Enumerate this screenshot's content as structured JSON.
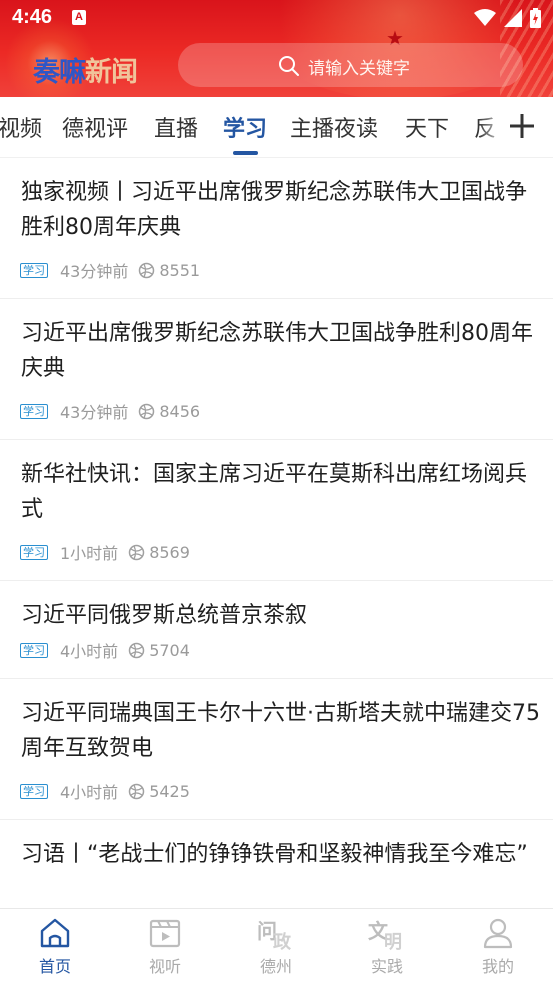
{
  "status_bar": {
    "time": "4:46",
    "app_badge": "A"
  },
  "header": {
    "logo_part1": "奏嘛",
    "logo_part2": "新闻",
    "search_placeholder": "请输入关键字",
    "brand_color": "#e8251f"
  },
  "tabs": {
    "items": [
      "视频",
      "德视评",
      "直播",
      "学习",
      "主播夜读",
      "天下",
      "反"
    ],
    "active_index": 3,
    "active_color": "#2456a2"
  },
  "news": [
    {
      "title": "独家视频丨习近平出席俄罗斯纪念苏联伟大卫国战争胜利80周年庆典",
      "tag": "学习",
      "time": "43分钟前",
      "views": "8551"
    },
    {
      "title": "习近平出席俄罗斯纪念苏联伟大卫国战争胜利80周年庆典",
      "tag": "学习",
      "time": "43分钟前",
      "views": "8456"
    },
    {
      "title": "新华社快讯：国家主席习近平在莫斯科出席红场阅兵式",
      "tag": "学习",
      "time": "1小时前",
      "views": "8569"
    },
    {
      "title": "习近平同俄罗斯总统普京茶叙",
      "tag": "学习",
      "time": "4小时前",
      "views": "5704"
    },
    {
      "title": "习近平同瑞典国王卡尔十六世·古斯塔夫就中瑞建交75周年互致贺电",
      "tag": "学习",
      "time": "4小时前",
      "views": "5425"
    },
    {
      "title": "习语丨“老战士们的铮铮铁骨和坚毅神情我至今难忘”"
    }
  ],
  "bottom_nav": [
    {
      "label": "首页",
      "icon": "home-icon",
      "active": true
    },
    {
      "label": "视听",
      "icon": "video-icon"
    },
    {
      "label": "德州",
      "icon": "wen-zheng-icon",
      "glyph_a": "问",
      "glyph_b": "政"
    },
    {
      "label": "实践",
      "icon": "wen-ming-icon",
      "glyph_a": "文",
      "glyph_b": "明"
    },
    {
      "label": "我的",
      "icon": "user-icon"
    }
  ]
}
